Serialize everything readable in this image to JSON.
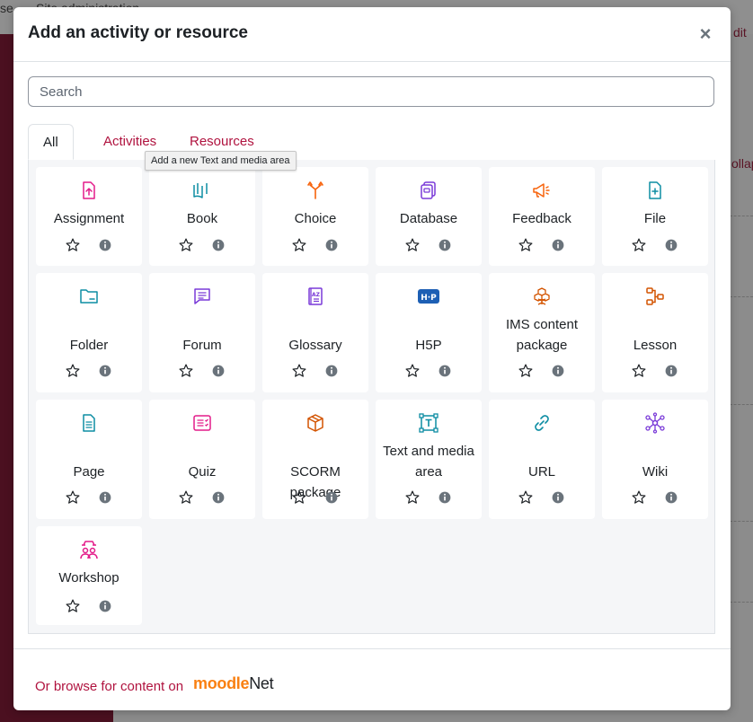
{
  "background": {
    "topbar_text_left": "se",
    "topbar_text": "Site administration",
    "right_link_top": "dit",
    "right_link_mid": "ollap"
  },
  "modal": {
    "title": "Add an activity or resource",
    "close_label": "×"
  },
  "search": {
    "placeholder": "Search",
    "value": ""
  },
  "tabs": [
    {
      "label": "All",
      "active": true
    },
    {
      "label": "Activities",
      "active": false
    },
    {
      "label": "Resources",
      "active": false
    }
  ],
  "tooltip": "Add a new Text and media area",
  "items": [
    {
      "name": "Assignment",
      "icon": "assignment-icon",
      "color": "#e31c8a"
    },
    {
      "name": "Book",
      "icon": "book-icon",
      "color": "#0d8da3"
    },
    {
      "name": "Choice",
      "icon": "choice-icon",
      "color": "#f7630c"
    },
    {
      "name": "Database",
      "icon": "database-icon",
      "color": "#7a3ad8"
    },
    {
      "name": "Feedback",
      "icon": "feedback-icon",
      "color": "#f7630c"
    },
    {
      "name": "File",
      "icon": "file-icon",
      "color": "#0d8da3"
    },
    {
      "name": "Folder",
      "icon": "folder-icon",
      "color": "#0d8da3"
    },
    {
      "name": "Forum",
      "icon": "forum-icon",
      "color": "#7a3ad8"
    },
    {
      "name": "Glossary",
      "icon": "glossary-icon",
      "color": "#7a3ad8"
    },
    {
      "name": "H5P",
      "icon": "h5p-icon",
      "color": "#1d5fb4"
    },
    {
      "name": "IMS content package",
      "icon": "ims-package-icon",
      "color": "#d35400"
    },
    {
      "name": "Lesson",
      "icon": "lesson-icon",
      "color": "#d35400"
    },
    {
      "name": "Page",
      "icon": "page-icon",
      "color": "#0d8da3"
    },
    {
      "name": "Quiz",
      "icon": "quiz-icon",
      "color": "#e31c8a"
    },
    {
      "name": "SCORM package",
      "icon": "scorm-icon",
      "color": "#d35400"
    },
    {
      "name": "Text and media area",
      "icon": "text-media-icon",
      "color": "#0d8da3"
    },
    {
      "name": "URL",
      "icon": "url-icon",
      "color": "#0d8da3"
    },
    {
      "name": "Wiki",
      "icon": "wiki-icon",
      "color": "#7a3ad8"
    },
    {
      "name": "Workshop",
      "icon": "workshop-icon",
      "color": "#e31c8a"
    }
  ],
  "footer": {
    "browse_text": "Or browse for content on",
    "brand_moodle": "moodle",
    "brand_net": "Net"
  }
}
